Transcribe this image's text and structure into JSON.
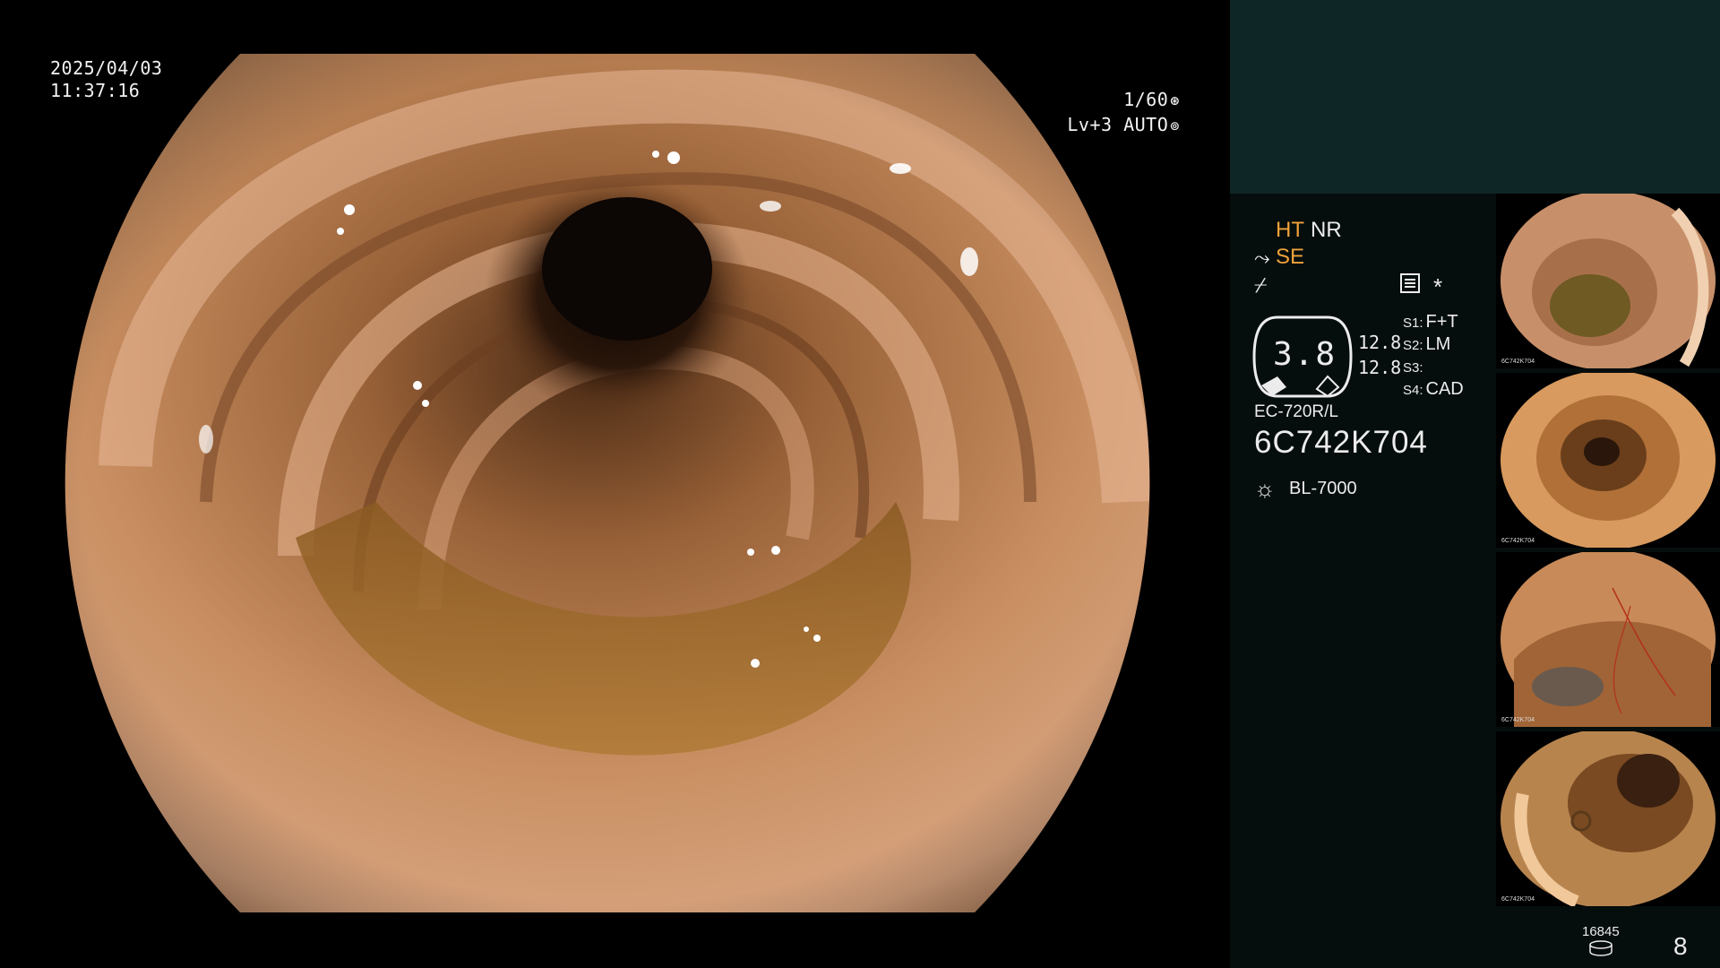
{
  "overlay": {
    "date": "2025/04/03",
    "time": "11:37:16",
    "shutter": "1/60",
    "shutter_icon": "aperture-icon",
    "iris": "Lv+3 AUTO",
    "iris_icon": "iris-icon"
  },
  "panel": {
    "ht": "HT",
    "nr": "NR",
    "se": "SE",
    "se_icon": "scope-tip-icon",
    "freeze_icon": "freeze-icon",
    "menu_icon": "settings-list-icon",
    "star_icon": "asterisk-icon",
    "gauge_value": "3.8",
    "value_1": "12.8",
    "value_2": "12.8",
    "switches": [
      {
        "key": "S1:",
        "value": "F+T"
      },
      {
        "key": "S2:",
        "value": "LM"
      },
      {
        "key": "S3:",
        "value": ""
      },
      {
        "key": "S4:",
        "value": "CAD"
      }
    ],
    "scope_model": "EC-720R/L",
    "scope_serial": "6C742K704",
    "light_icon": "light-source-icon",
    "light_model": "BL-7000",
    "storage_count": "16845",
    "storage_icon": "storage-disk-icon",
    "image_count": "8"
  },
  "thumbnails": [
    {
      "caption": "6C742K704"
    },
    {
      "caption": "6C742K704"
    },
    {
      "caption": "6C742K704"
    },
    {
      "caption": "6C742K704"
    }
  ],
  "colors": {
    "panel_background": "#060d0d",
    "panel_top_block": "#0f2626",
    "highlight": "#f0a23a",
    "text": "#ececec"
  }
}
